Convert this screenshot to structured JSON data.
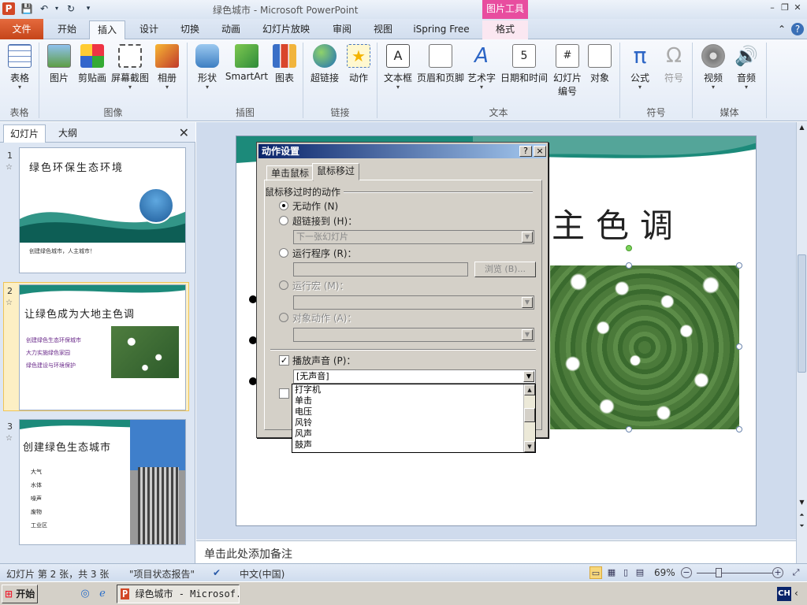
{
  "app": {
    "window_title": "绿色城市 - Microsoft PowerPoint",
    "context_tab_group": "图片工具",
    "app_icon": "P"
  },
  "tabs": [
    {
      "label": "文件"
    },
    {
      "label": "开始"
    },
    {
      "label": "插入"
    },
    {
      "label": "设计"
    },
    {
      "label": "切换"
    },
    {
      "label": "动画"
    },
    {
      "label": "幻灯片放映"
    },
    {
      "label": "审阅"
    },
    {
      "label": "视图"
    },
    {
      "label": "iSpring Free"
    },
    {
      "label": "格式"
    }
  ],
  "ribbon": {
    "buttons": {
      "table": "表格",
      "picture": "图片",
      "clipart": "剪贴画",
      "screenshot": "屏幕截图",
      "album": "相册",
      "shapes": "形状",
      "smartart": "SmartArt",
      "chart": "图表",
      "hyperlink": "超链接",
      "action": "动作",
      "textbox": "文本框",
      "header_footer": "页眉和页脚",
      "wordart": "艺术字",
      "datetime": "日期和时间",
      "slide_number": "幻灯片\n编号",
      "slide_number_l1": "幻灯片",
      "slide_number_l2": "编号",
      "object": "对象",
      "equation": "公式",
      "symbol": "符号",
      "video": "视频",
      "audio": "音频"
    },
    "groups": {
      "tables": "表格",
      "images": "图像",
      "illustrations": "插图",
      "links": "链接",
      "text": "文本",
      "symbols": "符号",
      "media": "媒体"
    }
  },
  "left_panel": {
    "tab_slides": "幻灯片",
    "tab_outline": "大纲",
    "slides": [
      {
        "number": "1",
        "title": "绿色环保生态环境",
        "line1": "创建绿色城市，人主城市！"
      },
      {
        "number": "2",
        "title": "让绿色成为大地主色调",
        "bullets": [
          "创建绿色生态环保城市",
          "大力实施绿色家园",
          "绿色建设与环境保护"
        ]
      },
      {
        "number": "3",
        "title": "创建绿色生态城市",
        "bullets": [
          "大气",
          "水体",
          "噪声",
          "废物",
          "工业区"
        ]
      }
    ]
  },
  "slide": {
    "title_visible": "主色调"
  },
  "notes": {
    "placeholder": "单击此处添加备注"
  },
  "dialog": {
    "title": "动作设置",
    "help_btn": "?",
    "close_btn": "×",
    "tab_click": "单击鼠标",
    "tab_hover": "鼠标移过",
    "section": "鼠标移过时的动作",
    "opt_none": "无动作 (N)",
    "opt_hyperlink": "超链接到 (H)：",
    "hyperlink_value": "下一张幻灯片",
    "opt_program": "运行程序 (R)：",
    "browse": "浏览 (B)...",
    "opt_macro": "运行宏 (M)：",
    "opt_object": "对象动作 (A)：",
    "play_sound": "播放声音 (P)：",
    "sound_value": "[无声音]",
    "sound_options": [
      "打字机",
      "单击",
      "电压",
      "风铃",
      "风声",
      "鼓声"
    ]
  },
  "status": {
    "slide_info": "幻灯片 第 2 张，共 3 张",
    "theme": "\"项目状态报告\"",
    "language": "中文(中国)",
    "zoom": "69%"
  },
  "taskbar": {
    "start": "开始",
    "ppt_task": "绿色城市 - Microsof...",
    "ime": "CH"
  }
}
